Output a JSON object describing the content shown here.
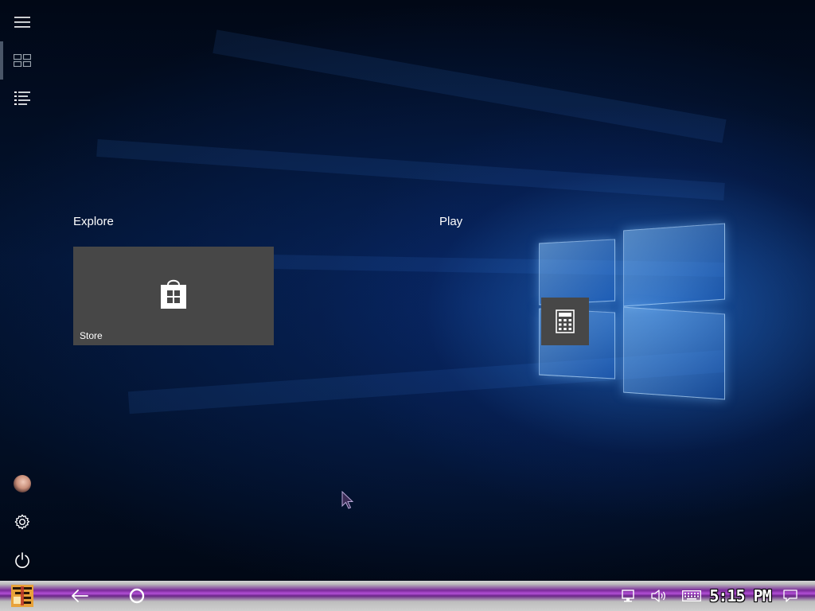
{
  "start": {
    "groups": [
      {
        "title": "Explore",
        "tiles": [
          {
            "label": "Store",
            "icon": "store-bag-icon"
          }
        ]
      },
      {
        "title": "Play",
        "tiles": [
          {
            "label": "",
            "icon": "calculator-icon"
          }
        ]
      }
    ],
    "sidebar_top": [
      {
        "name": "menu-icon"
      },
      {
        "name": "tiles-view-icon"
      },
      {
        "name": "all-apps-list-icon"
      }
    ],
    "sidebar_bottom": [
      {
        "name": "user-avatar"
      },
      {
        "name": "settings-gear-icon"
      },
      {
        "name": "power-icon"
      }
    ]
  },
  "taskbar": {
    "clock": "5:15 PM",
    "colors": {
      "accent_stripe": "#b24fd6",
      "tile": "#474747"
    },
    "icons": [
      "start-logo-icon",
      "back-arrow-icon",
      "cortana-circle-icon",
      "network-icon",
      "volume-icon",
      "keyboard-icon",
      "action-center-icon"
    ]
  }
}
